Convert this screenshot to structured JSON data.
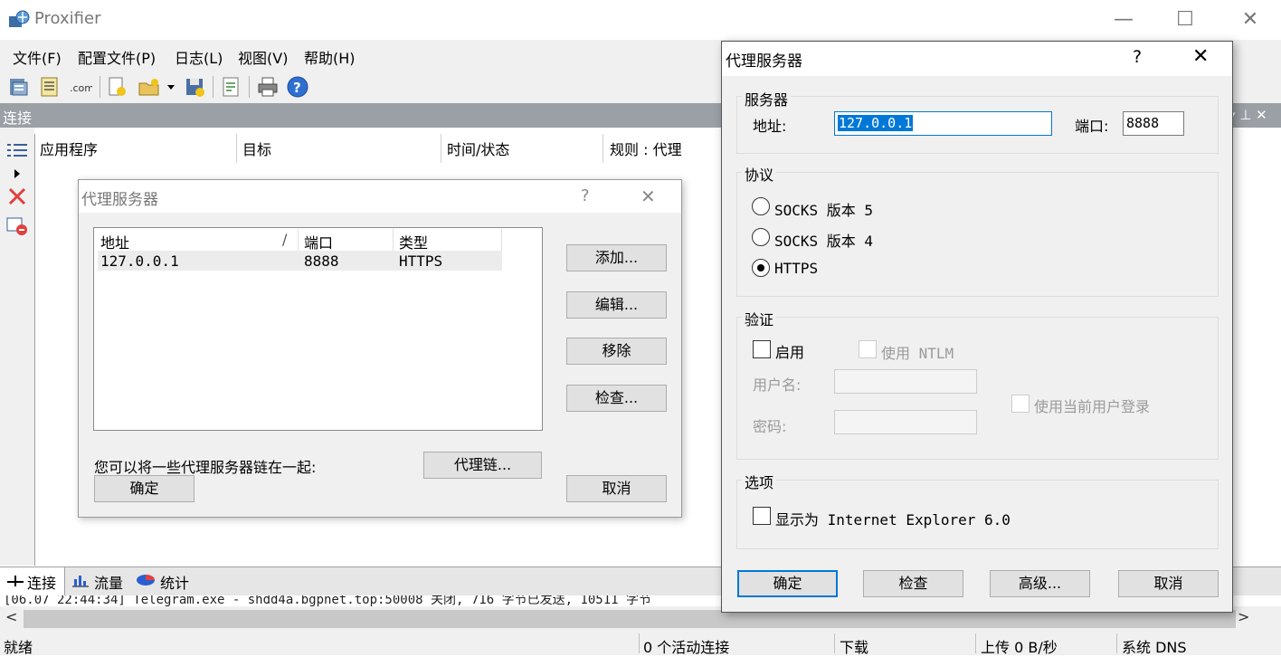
{
  "app": {
    "title": "Proxifier"
  },
  "window_controls": {
    "minimize": "—",
    "maximize": "☐",
    "close": "✕"
  },
  "menu": [
    "文件(F)",
    "配置文件(P)",
    "日志(L)",
    "视图(V)",
    "帮助(H)"
  ],
  "toolbar": {
    "icons": [
      "proxy-servers-icon",
      "proxification-rules-icon",
      "name-resolution-icon",
      "new-profile-icon",
      "open-profile-icon",
      "save-profile-icon",
      "profile-properties-icon",
      "print-icon",
      "help-icon"
    ]
  },
  "connections": {
    "title": "连接",
    "columns": [
      "应用程序",
      "目标",
      "时间/状态",
      "规则 : 代理"
    ]
  },
  "bottom_tabs": [
    "连接",
    "流量",
    "统计"
  ],
  "log": {
    "line": "[06.07 22:44:34] Telegram.exe - shdd4a.bgpnet.top:50008 关闭, 716 字节已发送, 10511 字节"
  },
  "status": {
    "ready": "就绪",
    "active": "0 个活动连接",
    "download": "下载",
    "upload": "上传 0 B/秒",
    "dns": "系统 DNS"
  },
  "dialog_list": {
    "title": "代理服务器",
    "help": "?",
    "close": "✕",
    "columns": {
      "address": "地址",
      "sort": "/",
      "port": "端口",
      "type": "类型"
    },
    "rows": [
      {
        "address": "127.0.0.1",
        "port": "8888",
        "type": "HTTPS"
      }
    ],
    "buttons": {
      "add": "添加...",
      "edit": "编辑...",
      "remove": "移除",
      "check": "检查...",
      "chain": "代理链...",
      "ok": "确定",
      "cancel": "取消"
    },
    "chain_note": "您可以将一些代理服务器链在一起:"
  },
  "dialog_edit": {
    "title": "代理服务器",
    "help": "?",
    "close": "✕",
    "server": {
      "group": "服务器",
      "address_label": "地址:",
      "address_value": "127.0.0.1",
      "port_label": "端口:",
      "port_value": "8888"
    },
    "protocol": {
      "group": "协议",
      "options": [
        "SOCKS 版本 5",
        "SOCKS 版本 4",
        "HTTPS"
      ],
      "selected": "HTTPS"
    },
    "auth": {
      "group": "验证",
      "enable": "启用",
      "ntlm": "使用 NTLM",
      "username_label": "用户名:",
      "password_label": "密码:",
      "current_user": "使用当前用户登录"
    },
    "options": {
      "group": "选项",
      "show_as_ie": "显示为 Internet Explorer 6.0"
    },
    "buttons": {
      "ok": "确定",
      "check": "检查",
      "advanced": "高级...",
      "cancel": "取消"
    }
  },
  "colors": {
    "accent": "#0078d7",
    "pane_header": "#9aa0a6"
  }
}
